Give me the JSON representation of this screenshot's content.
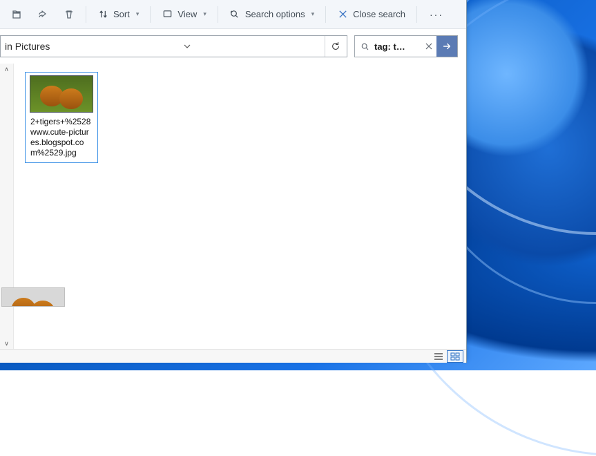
{
  "toolbar": {
    "sort_label": "Sort",
    "view_label": "View",
    "search_options_label": "Search options",
    "close_search_label": "Close search"
  },
  "address": {
    "text": "in Pictures"
  },
  "search": {
    "query": "tag: t…"
  },
  "items": [
    {
      "filename": "2+tigers+%2528www.cute-pictures.blogspot.com%2529.jpg"
    }
  ],
  "colors": {
    "accent": "#5b7bb4",
    "selection": "#3c91e6"
  }
}
